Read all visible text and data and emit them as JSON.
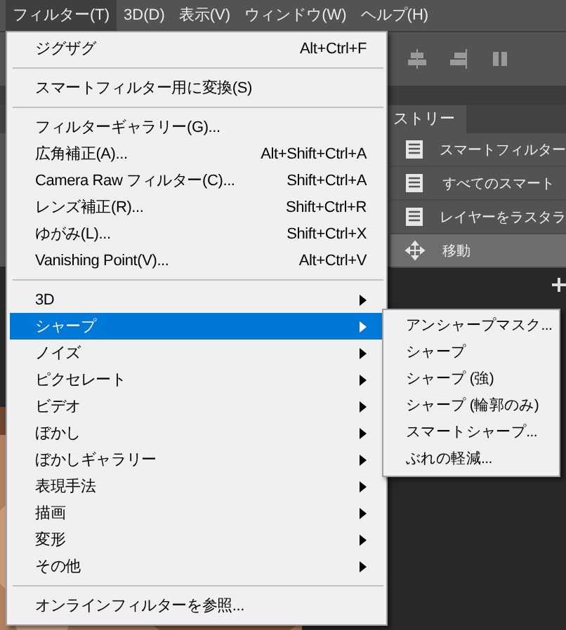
{
  "menubar": [
    {
      "label": "フィルター(T)",
      "selected": true
    },
    {
      "label": "3D(D)",
      "selected": false
    },
    {
      "label": "表示(V)",
      "selected": false
    },
    {
      "label": "ウィンドウ(W)",
      "selected": false
    },
    {
      "label": "ヘルプ(H)",
      "selected": false
    }
  ],
  "history_panel": {
    "tab": "ストリー",
    "rows": [
      {
        "label": "スマートフィルター",
        "kind": "document",
        "selected": false
      },
      {
        "label": "すべてのスマート",
        "kind": "document",
        "selected": false
      },
      {
        "label": "レイヤーをラスタラ",
        "kind": "document",
        "selected": false
      },
      {
        "label": "移動",
        "kind": "move",
        "selected": true
      }
    ]
  },
  "filter_menu": [
    {
      "kind": "command",
      "label": "ジグザグ",
      "shortcut": "Alt+Ctrl+F"
    },
    {
      "kind": "separator"
    },
    {
      "kind": "command",
      "label": "スマートフィルター用に変換(S)"
    },
    {
      "kind": "separator"
    },
    {
      "kind": "command",
      "label": "フィルターギャラリー(G)..."
    },
    {
      "kind": "command",
      "label": "広角補正(A)...",
      "shortcut": "Alt+Shift+Ctrl+A"
    },
    {
      "kind": "command",
      "label": "Camera Raw フィルター(C)...",
      "shortcut": "Shift+Ctrl+A"
    },
    {
      "kind": "command",
      "label": "レンズ補正(R)...",
      "shortcut": "Shift+Ctrl+R"
    },
    {
      "kind": "command",
      "label": "ゆがみ(L)...",
      "shortcut": "Shift+Ctrl+X"
    },
    {
      "kind": "command",
      "label": "Vanishing Point(V)...",
      "shortcut": "Alt+Ctrl+V"
    },
    {
      "kind": "separator"
    },
    {
      "kind": "submenu",
      "label": "3D",
      "selected": false
    },
    {
      "kind": "submenu",
      "label": "シャープ",
      "selected": true
    },
    {
      "kind": "submenu",
      "label": "ノイズ",
      "selected": false
    },
    {
      "kind": "submenu",
      "label": "ピクセレート",
      "selected": false
    },
    {
      "kind": "submenu",
      "label": "ビデオ",
      "selected": false
    },
    {
      "kind": "submenu",
      "label": "ぼかし",
      "selected": false
    },
    {
      "kind": "submenu",
      "label": "ぼかしギャラリー",
      "selected": false
    },
    {
      "kind": "submenu",
      "label": "表現手法",
      "selected": false
    },
    {
      "kind": "submenu",
      "label": "描画",
      "selected": false
    },
    {
      "kind": "submenu",
      "label": "変形",
      "selected": false
    },
    {
      "kind": "submenu",
      "label": "その他",
      "selected": false
    },
    {
      "kind": "separator"
    },
    {
      "kind": "command",
      "label": "オンラインフィルターを参照..."
    }
  ],
  "sharpen_submenu": [
    "アンシャープマスク...",
    "シャープ",
    "シャープ (強)",
    "シャープ (輪郭のみ)",
    "スマートシャープ...",
    "ぶれの軽減..."
  ]
}
